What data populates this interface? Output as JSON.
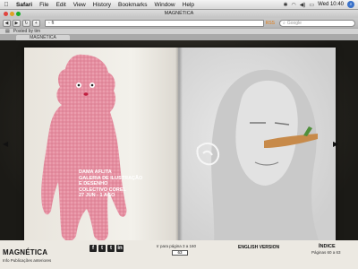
{
  "menubar": {
    "apple": "",
    "items": [
      "Safari",
      "File",
      "Edit",
      "View",
      "History",
      "Bookmarks",
      "Window",
      "Help"
    ],
    "time": "Wed 10:40"
  },
  "window": {
    "title": "MAGNÉTICA"
  },
  "toolbar": {
    "address_value": "ft",
    "search_placeholder": "Google"
  },
  "bookmarks": {
    "items": [
      "Posted by tim"
    ]
  },
  "tabs": [
    {
      "label": "MAGNÉTICA"
    }
  ],
  "article": {
    "lines": [
      "DAMA AFLITA",
      "GALERIA DE ILUSTRAÇÃO",
      "E DESENHO",
      "COLECTIVO COREL",
      "27 JUN - 1 AGO"
    ]
  },
  "footer": {
    "logo": "MAGNÉTICA",
    "logo_sub": "Info Publicações anteriores",
    "social": [
      "f",
      "t",
      "t",
      "in"
    ],
    "goto_label": "Ir para página 3 a 160",
    "goto_value": "63",
    "english": "ENGLISH VERSION",
    "index": "ÍNDICE",
    "pages": "Páginas 60 a 63"
  }
}
